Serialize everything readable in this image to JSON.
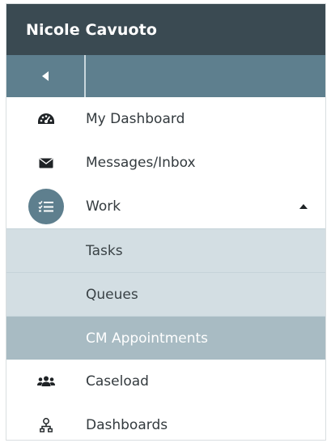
{
  "header": {
    "title": "Nicole Cavuoto"
  },
  "sidebar": {
    "collapse_icon": "caret-left-icon",
    "items": [
      {
        "label": "My Dashboard",
        "icon": "tachometer-icon"
      },
      {
        "label": "Messages/Inbox",
        "icon": "envelope-icon"
      },
      {
        "label": "Work",
        "icon": "task-list-icon",
        "expanded": true,
        "children": [
          {
            "label": "Tasks"
          },
          {
            "label": "Queues"
          },
          {
            "label": "CM Appointments",
            "active": true
          }
        ]
      },
      {
        "label": "Caseload",
        "icon": "users-icon"
      },
      {
        "label": "Dashboards",
        "icon": "org-chart-icon"
      }
    ]
  },
  "colors": {
    "header_bg": "#3a4a52",
    "accent": "#5e7f8e",
    "submenu_bg": "#d3dee3",
    "submenu_active_bg": "#a8bbc3"
  }
}
